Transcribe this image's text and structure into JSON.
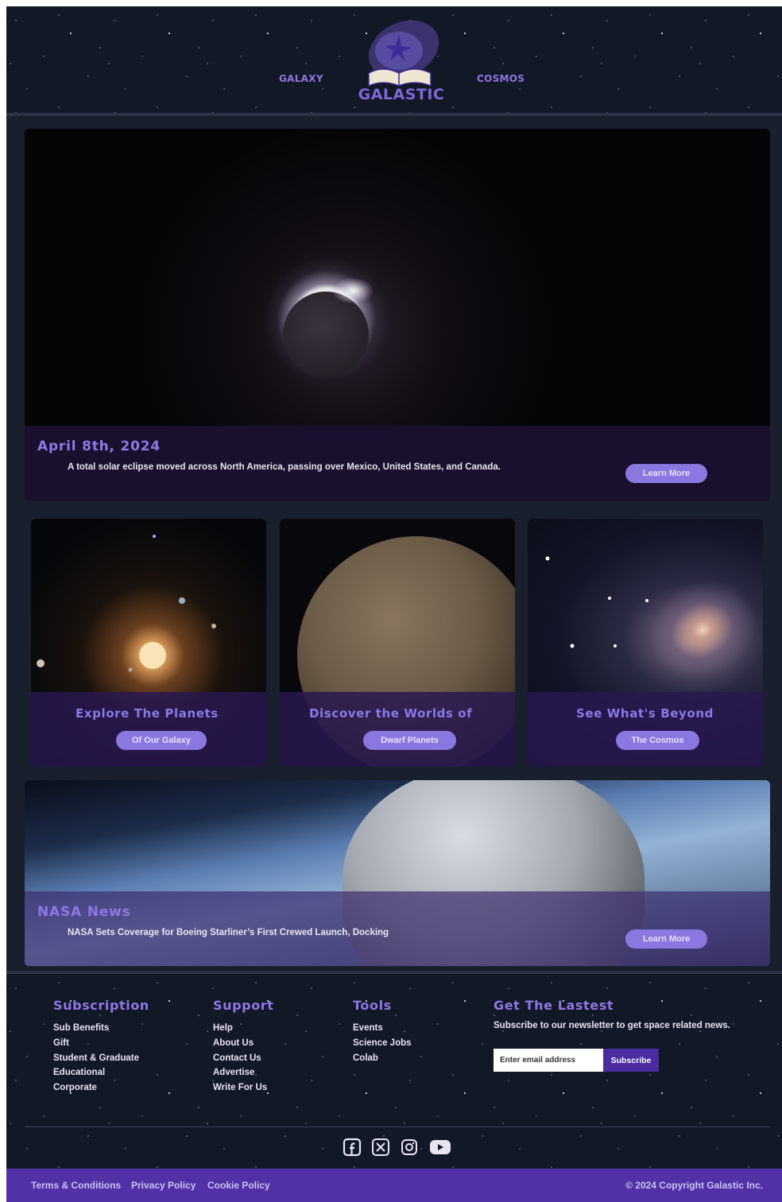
{
  "header": {
    "nav_left": "GALAXY",
    "nav_right": "COSMOS",
    "logo_text": "GALASTIC"
  },
  "hero": {
    "title": "April 8th, 2024",
    "text": "A total solar eclipse moved across North America, passing over Mexico, United States, and Canada.",
    "button": "Learn More"
  },
  "cards": [
    {
      "title": "Explore The Planets",
      "button": "Of Our Galaxy"
    },
    {
      "title": "Discover the Worlds of",
      "button": "Dwarf Planets"
    },
    {
      "title": "See What's Beyond",
      "button": "The Cosmos"
    }
  ],
  "nasa": {
    "title": "NASA News",
    "text": "NASA Sets Coverage for Boeing Starliner’s First Crewed Launch, Docking",
    "button": "Learn More"
  },
  "footer": {
    "columns": [
      {
        "heading": "Subscription",
        "links": [
          "Sub Benefits",
          "Gift",
          "Student & Graduate",
          "Educational",
          "Corporate"
        ]
      },
      {
        "heading": "Support",
        "links": [
          "Help",
          "About Us",
          "Contact Us",
          "Advertise",
          "Write For Us"
        ]
      },
      {
        "heading": "Tools",
        "links": [
          "Events",
          "Science Jobs",
          "Colab"
        ]
      }
    ],
    "newsletter": {
      "heading": "Get The Lastest",
      "text": "Subscribe to our newsletter to get space related news.",
      "placeholder": "Enter email address",
      "button": "Subscribe"
    },
    "social_icons": [
      "facebook-icon",
      "x-icon",
      "instagram-icon",
      "youtube-icon"
    ]
  },
  "bottom_bar": {
    "links": [
      "Terms & Conditions",
      "Privacy Policy",
      "Cookie Policy"
    ],
    "copyright": "© 2024 Copyright Galastic Inc."
  },
  "colors": {
    "accent": "#8c78e6",
    "button": "#8a77e0",
    "bottom_bar": "#5230a6",
    "background": "#1a1f2e"
  }
}
